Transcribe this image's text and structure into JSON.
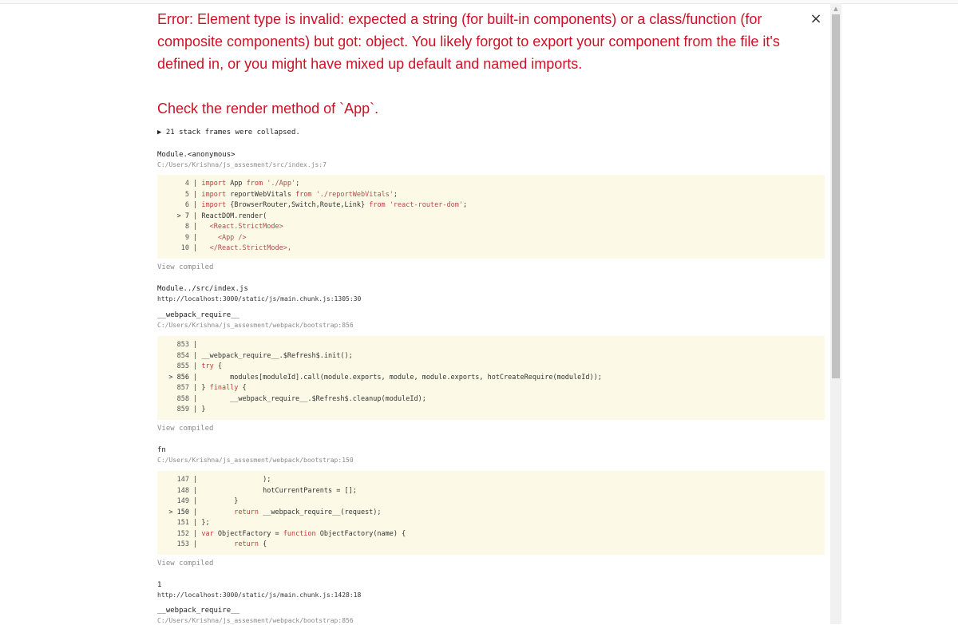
{
  "error": {
    "message": "Error: Element type is invalid: expected a string (for built-in components) or a class/function (for composite components) but got: object. You likely forgot to export your component from the file it's defined in, or you might have mixed up default and named imports.",
    "check": "Check the render method of `App`.",
    "close_symbol": "×"
  },
  "collapsed": "▶ 21 stack frames were collapsed.",
  "frames": [
    {
      "name": "Module.<anonymous>",
      "location": "C:/Users/Krishna/js_assesment/src/index.js:7",
      "code": [
        {
          "marker": " ",
          "num": "4",
          "text": "import App from './App';"
        },
        {
          "marker": " ",
          "num": "5",
          "text": "import reportWebVitals from './reportWebVitals';"
        },
        {
          "marker": " ",
          "num": "6",
          "text": "import {BrowserRouter,Switch,Route,Link} from 'react-router-dom';"
        },
        {
          "marker": ">",
          "num": "7",
          "text": "ReactDOM.render("
        },
        {
          "marker": " ",
          "num": "8",
          "text": "  <React.StrictMode>"
        },
        {
          "marker": " ",
          "num": "9",
          "text": "    <App />"
        },
        {
          "marker": " ",
          "num": "10",
          "text": "  </React.StrictMode>,"
        }
      ],
      "view_compiled": "View compiled"
    },
    {
      "name": "Module../src/index.js",
      "location": "http://localhost:3000/static/js/main.chunk.js:1305:30"
    },
    {
      "name": "__webpack_require__",
      "location": "C:/Users/Krishna/js_assesment/webpack/bootstrap:856",
      "code": [
        {
          "marker": " ",
          "num": "853",
          "text": ""
        },
        {
          "marker": " ",
          "num": "854",
          "text": "__webpack_require__.$Refresh$.init();"
        },
        {
          "marker": " ",
          "num": "855",
          "text": "try {"
        },
        {
          "marker": ">",
          "num": "856",
          "text": "       modules[moduleId].call(module.exports, module, module.exports, hotCreateRequire(moduleId));"
        },
        {
          "marker": " ",
          "num": "857",
          "text": "} finally {"
        },
        {
          "marker": " ",
          "num": "858",
          "text": "       __webpack_require__.$Refresh$.cleanup(moduleId);"
        },
        {
          "marker": " ",
          "num": "859",
          "text": "}"
        }
      ],
      "view_compiled": "View compiled"
    },
    {
      "name": "fn",
      "location": "C:/Users/Krishna/js_assesment/webpack/bootstrap:150",
      "code": [
        {
          "marker": " ",
          "num": "147",
          "text": "               );"
        },
        {
          "marker": " ",
          "num": "148",
          "text": "               hotCurrentParents = [];"
        },
        {
          "marker": " ",
          "num": "149",
          "text": "        }"
        },
        {
          "marker": ">",
          "num": "150",
          "text": "        return __webpack_require__(request);"
        },
        {
          "marker": " ",
          "num": "151",
          "text": "};"
        },
        {
          "marker": " ",
          "num": "152",
          "text": "var ObjectFactory = function ObjectFactory(name) {"
        },
        {
          "marker": " ",
          "num": "153",
          "text": "        return {"
        }
      ],
      "view_compiled": "View compiled"
    },
    {
      "name": "1",
      "location": "http://localhost:3000/static/js/main.chunk.js:1428:18"
    },
    {
      "name": "__webpack_require__",
      "location": "C:/Users/Krishna/js_assesment/webpack/bootstrap:856"
    }
  ],
  "colors": {
    "error_red": "#ce1126",
    "code_bg": "#fcfae6",
    "muted": "#8a8a8a"
  }
}
